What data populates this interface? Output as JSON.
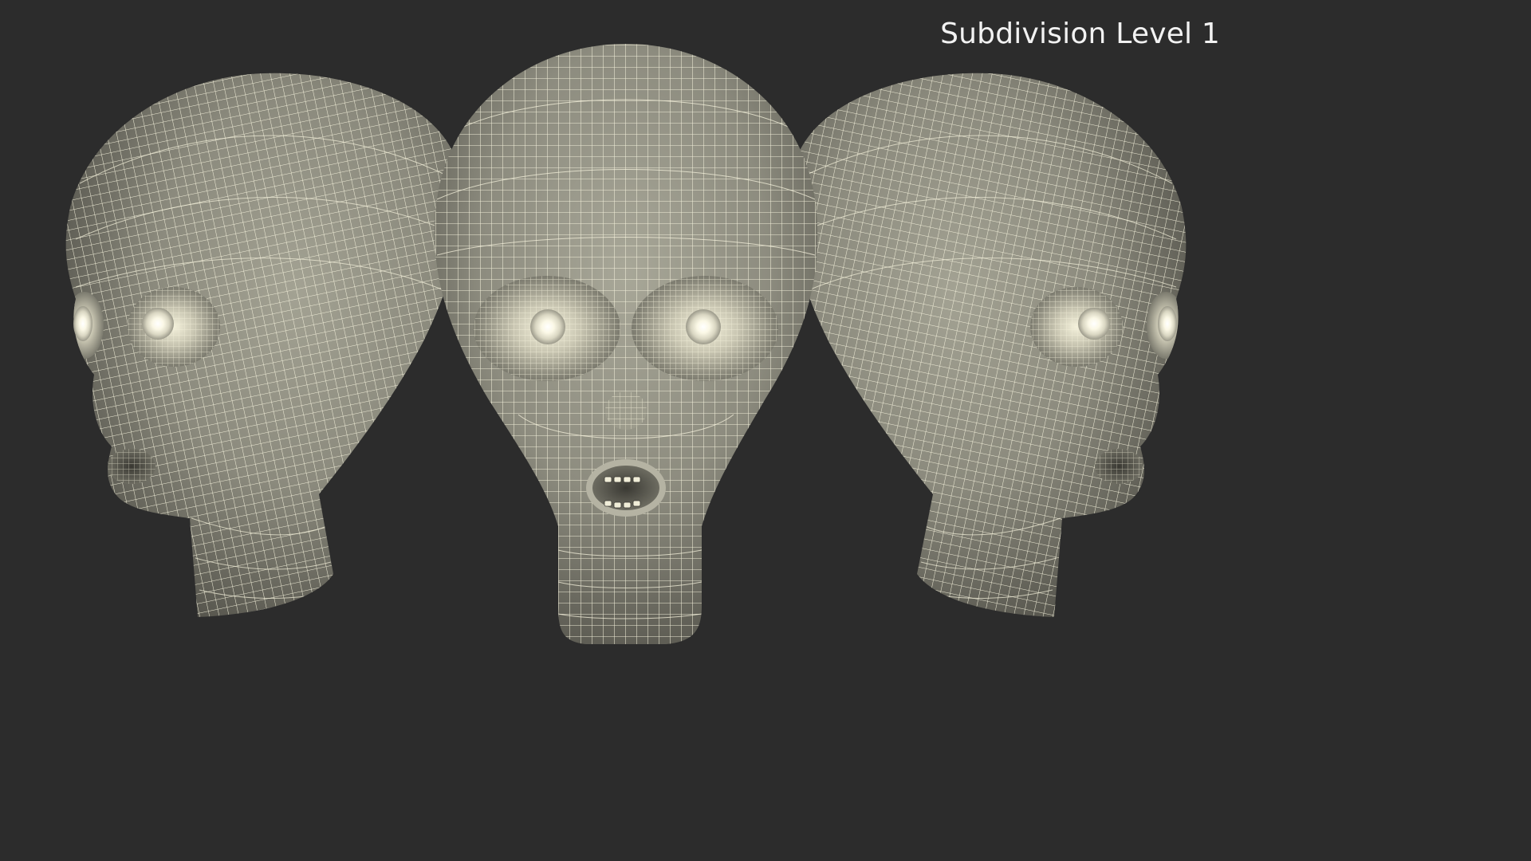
{
  "viewport": {
    "label": "Subdivision Level 1",
    "background": "#2c2c2c"
  },
  "model": {
    "views": [
      "left-three-quarter",
      "front",
      "right-three-quarter"
    ],
    "surface_color": "#8c8b7e",
    "wire_color": "#f5f2dc",
    "eye_color": "#fbf8e6"
  }
}
